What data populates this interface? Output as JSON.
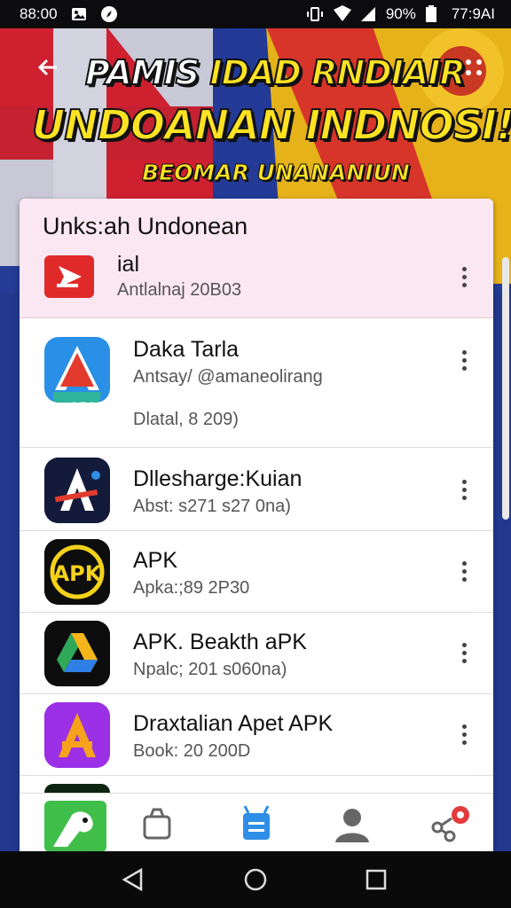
{
  "status_bar": {
    "time_left": "88:00",
    "battery": "90%",
    "time_right": "77:9AI",
    "icons": [
      "gallery-icon",
      "compass-icon",
      "vibrate-icon",
      "wifi-icon",
      "signal-icon",
      "battery-icon"
    ]
  },
  "banner": {
    "line1_white": "PAMIS",
    "line1_yellow": " IDAD RNDIAIR",
    "line2": "UNDOANAN INDNOSI!",
    "line3": "BEOMAR UNANANIUN"
  },
  "list": {
    "header_title": "Unks:ah Undonean",
    "featured": {
      "name": "ial",
      "subtitle": "Antlalnaj 20B03"
    },
    "items": [
      {
        "name": "Daka Tarla",
        "subtitle": "Antsay/ @amaneolirang",
        "extra": "Dlatal, 8 209)",
        "icon": "apk-pencil-icon"
      },
      {
        "name": "Dllesharge:Kuian",
        "subtitle": "Abst: s271 s27 0na)",
        "extra": "",
        "icon": "apk-a-icon"
      },
      {
        "name": "APK",
        "subtitle": "Apka:;89 2P30",
        "extra": "",
        "icon": "apk-yellow-icon"
      },
      {
        "name": "APK. Beakth aPK",
        "subtitle": "Npalc; 201 s060na)",
        "extra": "",
        "icon": "drive-triangle-icon"
      },
      {
        "name": "Draxtalian Apet APK",
        "subtitle": "Book: 20 200D",
        "extra": "",
        "icon": "purple-a-icon"
      }
    ]
  },
  "bottom_nav": {
    "items": [
      "dino-app-icon",
      "backpack-icon",
      "android-icon",
      "profile-icon",
      "share-icon"
    ],
    "active_index": 2,
    "active_color": "#2f8ee6",
    "notification_color": "#e23b3b"
  },
  "colors": {
    "banner_yellow": "#ffe323",
    "header_pink": "#fbe7f1",
    "youtube_red": "#e02a2a"
  }
}
